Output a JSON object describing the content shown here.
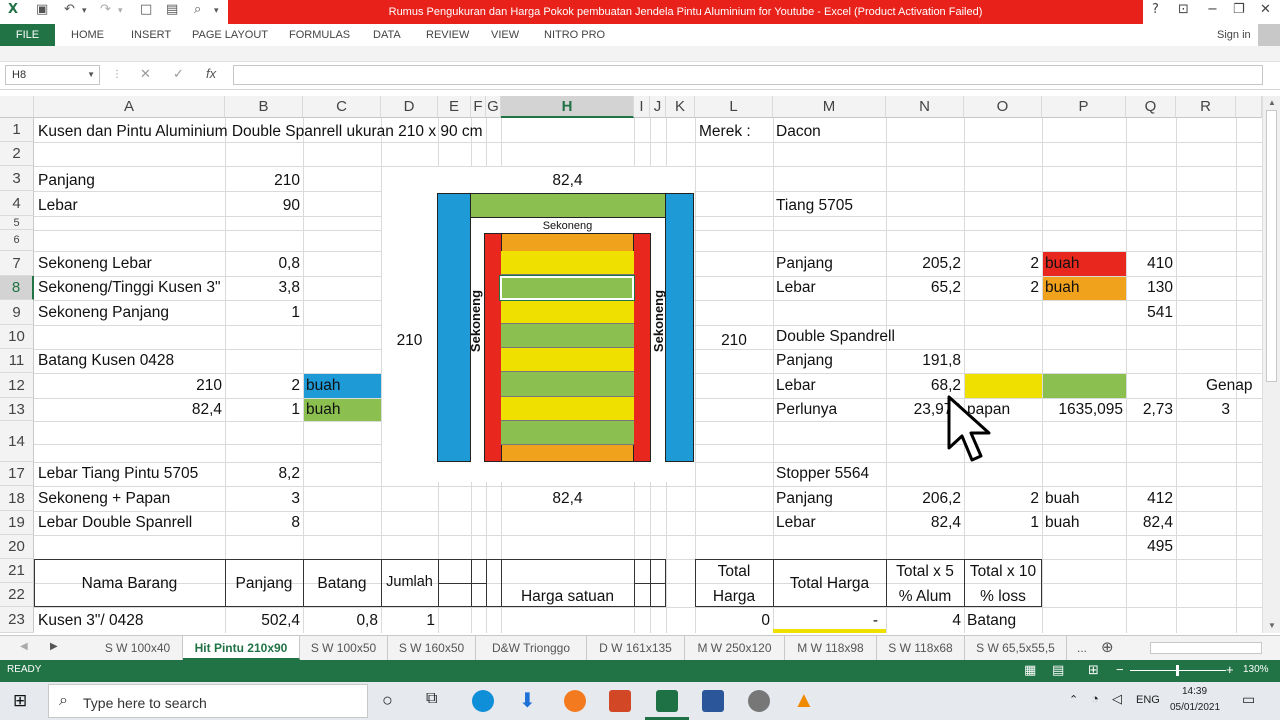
{
  "window": {
    "title": "Rumus Pengukuran dan Harga Pokok pembuatan Jendela Pintu Aluminium for Youtube -  Excel (Product Activation Failed)"
  },
  "ribbon": {
    "file": "FILE",
    "tabs": [
      "HOME",
      "INSERT",
      "PAGE LAYOUT",
      "FORMULAS",
      "DATA",
      "REVIEW",
      "VIEW",
      "NITRO PRO"
    ],
    "signin": "Sign in"
  },
  "formula_bar": {
    "name_box": "H8",
    "formula": ""
  },
  "columns": [
    "A",
    "B",
    "C",
    "D",
    "E",
    "F",
    "G",
    "H",
    "I",
    "J",
    "K",
    "L",
    "M",
    "N",
    "O",
    "P",
    "Q",
    "R"
  ],
  "rows": [
    "1",
    "2",
    "3",
    "4",
    "5",
    "6",
    "7",
    "8",
    "9",
    "10",
    "11",
    "12",
    "13",
    "14",
    "17",
    "18",
    "19",
    "20",
    "21",
    "22",
    "23"
  ],
  "cells": {
    "a1": "Kusen dan Pintu Aluminium Double Spanrell ukuran 210 x 90 cm",
    "l1": "Merek :",
    "m1": "Dacon",
    "a3": "Panjang",
    "b3": "210",
    "h3": "82,4",
    "a4": "Lebar",
    "b4": "90",
    "m4": "Tiang 5705",
    "sekoneng_top": "Sekoneng",
    "a7": "Sekoneng Lebar",
    "b7": "0,8",
    "m7": "Panjang",
    "n7": "205,2",
    "o7": "2",
    "p7": "buah",
    "q7": "410",
    "a8": "Sekoneng/Tinggi Kusen 3\"",
    "b8": "3,8",
    "m8": "Lebar",
    "n8": "65,2",
    "o8": "2",
    "p8": "buah",
    "q8": "130",
    "a9": "Sekoneng Panjang",
    "b9": "1",
    "q9": "541",
    "d10": "210",
    "l10": "210",
    "m10": "Double Spandrell",
    "sekoneng_left": "Sekoneng",
    "sekoneng_right": "Sekoneng",
    "a11": "Batang Kusen 0428",
    "m11": "Panjang",
    "n11": "191,8",
    "a12": "210",
    "b12": "2",
    "c12": "buah",
    "m12": "Lebar",
    "n12": "68,2",
    "r12": "Genap",
    "a13": "82,4",
    "b13": "1",
    "c13": "buah",
    "m13": "Perlunya",
    "n13": "23,976",
    "o13": "papan",
    "p13": "1635,095",
    "q13": "2,73",
    "r13": "3",
    "a17": "Lebar Tiang Pintu 5705",
    "b17": "8,2",
    "m17": "Stopper 5564",
    "a18": "Sekoneng + Papan",
    "b18": "3",
    "h18": "82,4",
    "m18": "Panjang",
    "n18": "206,2",
    "o18": "2",
    "p18": "buah",
    "q18": "412",
    "a19": "Lebar Double Spanrell",
    "b19": "8",
    "m19": "Lebar",
    "n19": "82,4",
    "o19": "1",
    "p19": "buah",
    "q19": "82,4",
    "q20": "495",
    "h_nama": "Nama Barang",
    "h_panjang": "Panjang",
    "h_batang": "Batang",
    "h_jumlah": "Jumlah",
    "h_harga": "Harga satuan",
    "h_total1": "Total",
    "h_total2": "Harga",
    "h_totalharga": "Total Harga",
    "h_x5a": "Total x 5",
    "h_x5b": "% Alum",
    "h_x10a": "Total x 10",
    "h_x10b": "% loss",
    "a23": "Kusen 3\"/ 0428",
    "b23": "502,4",
    "c23": "0,8",
    "d23": "1",
    "l23": "0",
    "m23": "-",
    "n23": "4",
    "o23": "Batang"
  },
  "sheet_tabs": [
    "S W 100x40",
    "Hit Pintu 210x90",
    "S W 100x50",
    "S W 160x50",
    "D&W Trionggo",
    "D W 161x135",
    "M W 250x120",
    "M W 118x98",
    "S W 118x68",
    "S W 65,5x55,5",
    "..."
  ],
  "active_tab": "Hit Pintu 210x90",
  "status": {
    "ready": "READY",
    "zoom": "130%"
  },
  "taskbar": {
    "search_placeholder": "Type here to search",
    "lang": "ENG",
    "time": "14:39",
    "date": "05/01/2021"
  },
  "colors": {
    "excel_green": "#217346",
    "title_red": "#e8221b",
    "blue": "#1e9ad6",
    "red": "#e8281e",
    "orange": "#f0a21c",
    "yellow": "#f0e000",
    "green": "#8bbf4f"
  }
}
